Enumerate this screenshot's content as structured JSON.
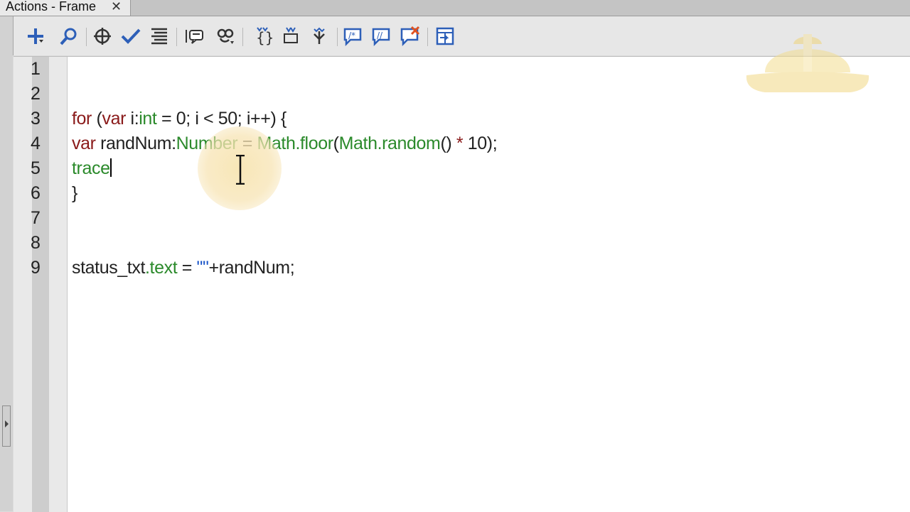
{
  "tab": {
    "title": "Actions - Frame",
    "close_glyph": "✕"
  },
  "toolbar": {
    "icons": [
      "add-statement-icon",
      "find-icon",
      "target-path-icon",
      "check-syntax-icon",
      "auto-format-icon",
      "code-hint-icon",
      "debug-options-icon",
      "collapse-between-braces-icon",
      "collapse-selection-icon",
      "expand-all-icon",
      "apply-block-comment-icon",
      "apply-line-comment-icon",
      "remove-comment-icon",
      "show-hide-toolbox-icon"
    ]
  },
  "editor": {
    "line_numbers": [
      "1",
      "2",
      "3",
      "4",
      "5",
      "6",
      "7",
      "8",
      "9"
    ],
    "lines": {
      "l3": {
        "kw_for": "for",
        "p1": " (",
        "kw_var": "var",
        "p2": " i:",
        "type_int": "int",
        "p3": " = 0; i < 50; i++) {"
      },
      "l4": {
        "kw_var": "var",
        "p1": " randNum:",
        "type_number": "Number",
        "p2": " = ",
        "math_floor": "Math.floor",
        "p3": "(",
        "math_random": "Math.random",
        "p4": "() ",
        "star": "*",
        "p5": " 10);"
      },
      "l5": {
        "fn_trace": "trace"
      },
      "l6": {
        "brace": "}"
      },
      "l9": {
        "p1": "status_txt",
        "prop_text": ".text",
        "p2": " = ",
        "str": "\"\"",
        "p3": "+randNum;"
      }
    }
  },
  "colors": {
    "keyword": "#8a1a1a",
    "type": "#2b8a2b",
    "string": "#1a55c8",
    "cursor_highlight": "#f7e2aa"
  }
}
